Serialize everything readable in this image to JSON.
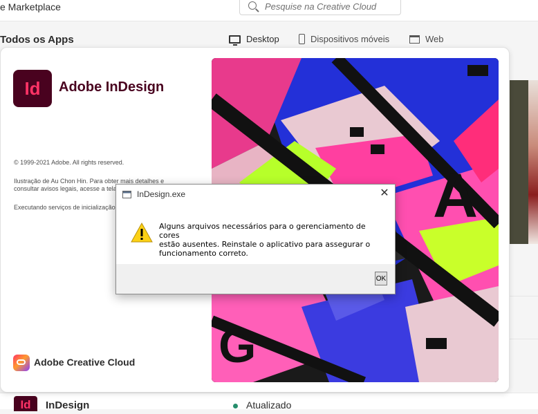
{
  "header": {
    "marketplace_label": "e Marketplace",
    "search_placeholder": "Pesquise na Creative Cloud"
  },
  "apps_section": {
    "title": "Todos os Apps",
    "device_tabs": [
      "Desktop",
      "Dispositivos móveis",
      "Web"
    ]
  },
  "splash": {
    "app_icon_text": "Id",
    "product_name": "Adobe InDesign",
    "copyright": "© 1999-2021 Adobe. All rights reserved.",
    "illustration_line1": "Ilustração de Au Chon Hin. Para obter mais detalhes e",
    "illustration_line2": "consultar avisos legais, acesse a tela",
    "loading_text": "Executando serviços de inicialização...",
    "footer_brand": "Adobe Creative Cloud"
  },
  "dialog": {
    "title": "InDesign.exe",
    "message_line1": "Alguns arquivos necessários para o gerenciamento de cores",
    "message_line2": "estão ausentes. Reinstale o aplicativo para assegurar o",
    "message_line3": "funcionamento correto.",
    "ok_label": "OK",
    "close_symbol": "✕"
  },
  "app_list_row": {
    "icon_text": "Id",
    "name": "InDesign",
    "status": "Atualizado",
    "status_color": "#268e6c"
  },
  "colors": {
    "indesign_dark": "#49021f",
    "indesign_pink": "#ff3366"
  }
}
